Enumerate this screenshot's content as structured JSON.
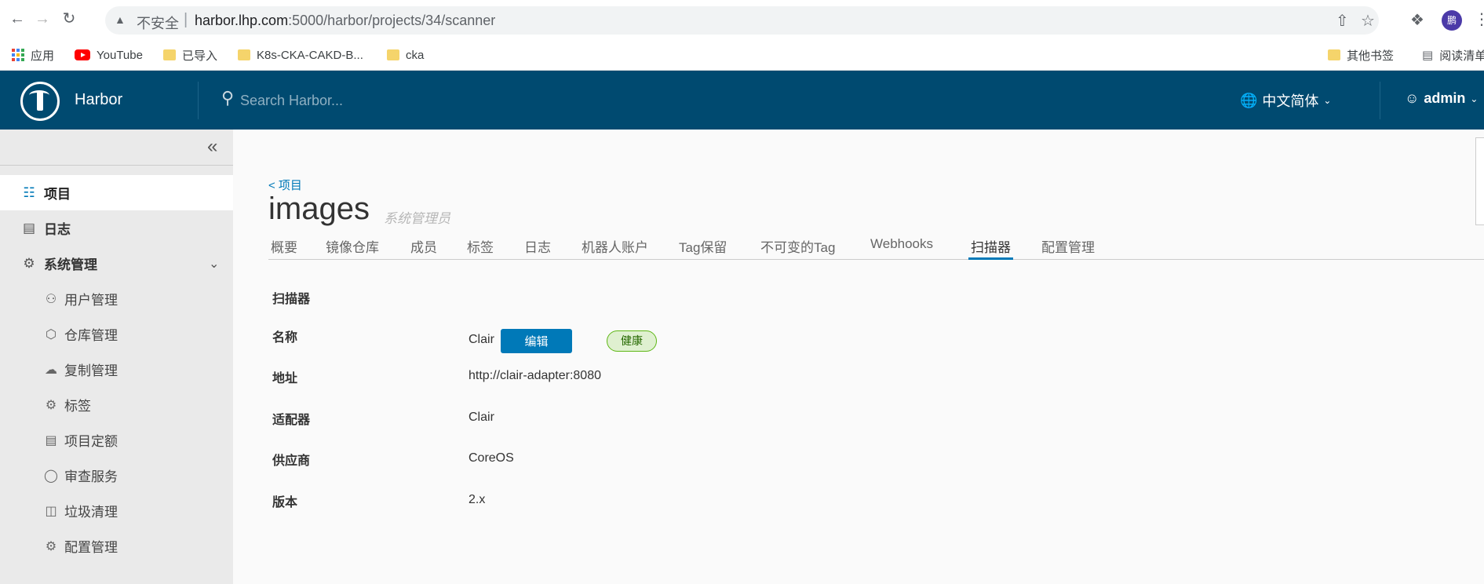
{
  "browser": {
    "insecure_label": "不安全",
    "url_host": "harbor.lhp.com",
    "url_path": ":5000/harbor/projects/34/scanner",
    "profile_initial": "鹏",
    "bookmarks": [
      {
        "label": "应用"
      },
      {
        "label": "YouTube"
      },
      {
        "label": "已导入"
      },
      {
        "label": "K8s-CKA-CAKD-B..."
      },
      {
        "label": "cka"
      },
      {
        "label": "其他书签"
      },
      {
        "label": "阅读清单"
      }
    ]
  },
  "header": {
    "brand": "Harbor",
    "search_placeholder": "Search Harbor...",
    "language": "中文简体",
    "user": "admin"
  },
  "sidebar": {
    "items": [
      {
        "label": "项目",
        "icon": "project-icon"
      },
      {
        "label": "日志",
        "icon": "log-icon"
      },
      {
        "label": "系统管理",
        "icon": "admin-icon"
      }
    ],
    "sub_items": [
      {
        "label": "用户管理",
        "icon": "users-icon"
      },
      {
        "label": "仓库管理",
        "icon": "registry-icon"
      },
      {
        "label": "复制管理",
        "icon": "replication-icon"
      },
      {
        "label": "标签",
        "icon": "tag-icon"
      },
      {
        "label": "项目定额",
        "icon": "quota-icon"
      },
      {
        "label": "审查服务",
        "icon": "shield-icon"
      },
      {
        "label": "垃圾清理",
        "icon": "trash-icon"
      },
      {
        "label": "配置管理",
        "icon": "gear-icon"
      }
    ]
  },
  "main": {
    "breadcrumb": "< 项目",
    "title": "images",
    "subtitle": "系统管理员",
    "tabs": [
      {
        "label": "概要"
      },
      {
        "label": "镜像仓库"
      },
      {
        "label": "成员"
      },
      {
        "label": "标签"
      },
      {
        "label": "日志"
      },
      {
        "label": "机器人账户"
      },
      {
        "label": "Tag保留"
      },
      {
        "label": "不可变的Tag"
      },
      {
        "label": "Webhooks"
      },
      {
        "label": "扫描器"
      },
      {
        "label": "配置管理"
      }
    ],
    "active_tab": "扫描器",
    "scanner": {
      "section_title": "扫描器",
      "rows": [
        {
          "label": "名称",
          "value": "Clair"
        },
        {
          "label": "地址",
          "value": "http://clair-adapter:8080"
        },
        {
          "label": "适配器",
          "value": "Clair"
        },
        {
          "label": "供应商",
          "value": "CoreOS"
        },
        {
          "label": "版本",
          "value": "2.x"
        }
      ],
      "edit_label": "编辑",
      "health_label": "健康"
    }
  },
  "colors": {
    "header_bg": "#004a70",
    "accent": "#0079b8",
    "healthy_green": "#5eb715"
  }
}
